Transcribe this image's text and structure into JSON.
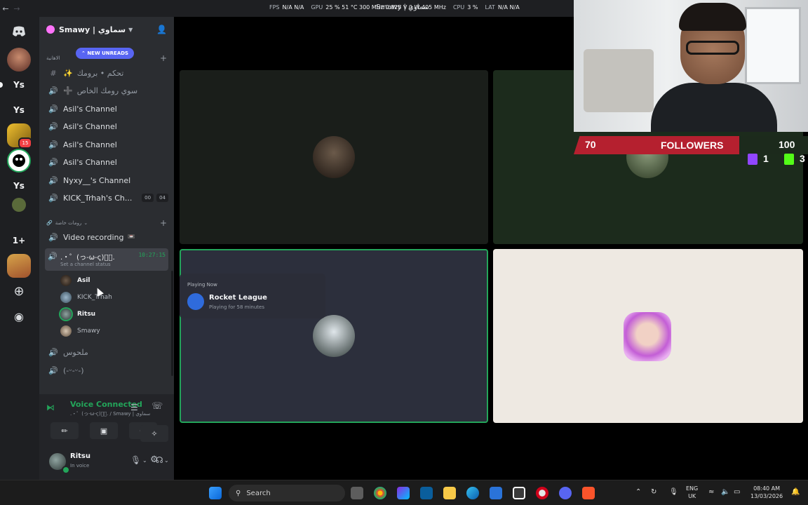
{
  "perf": [
    {
      "k": "FPS",
      "v": "N/A N/A"
    },
    {
      "k": "GPU",
      "v": "25 % 51 °C 300 MHz 0.825 V 0 W 405 MHz"
    },
    {
      "k": "CPU",
      "v": "3 %"
    },
    {
      "k": "LAT",
      "v": "N/A N/A"
    }
  ],
  "window_title": "Smawy | سماوي",
  "server": {
    "name": "Smawy | سماوي",
    "new_unreads": "NEW UNREADS",
    "categories": {
      "top": "الاهانية",
      "private": "رومات خاصة"
    },
    "channels": [
      {
        "icon": "#",
        "name": "تحكم • برومك",
        "emoji": "✨"
      },
      {
        "icon": "speaker",
        "name": "سوي رومك الخاص",
        "emoji": "➕"
      },
      {
        "icon": "speaker",
        "name": "Asil's Channel"
      },
      {
        "icon": "speaker",
        "name": "Asil's Channel"
      },
      {
        "icon": "speaker",
        "name": "Asil's Channel"
      },
      {
        "icon": "speaker",
        "name": "Asil's Channel"
      },
      {
        "icon": "speaker",
        "name": "Nyxy__'s Channel"
      },
      {
        "icon": "speaker",
        "name": "KICK_Trhah's Ch...",
        "count_a": "00",
        "count_b": "04"
      },
      {
        "icon": "speaker",
        "name": "Video recording",
        "emoji": "📼"
      }
    ],
    "active_channel": {
      "name": ".・゜(っ-ω-ς)ﾟ・.",
      "status": "Set a channel status",
      "timer": "10:27:15"
    },
    "voice_users": [
      {
        "name": "Asil"
      },
      {
        "name": "KICK_Trhah"
      },
      {
        "name": "Ritsu"
      },
      {
        "name": "Smawy"
      }
    ],
    "more_channels": [
      {
        "name": "ملحوس"
      },
      {
        "name": "(-ᵕ-ᵕ-)"
      }
    ]
  },
  "rail": {
    "badge_count": "15",
    "ys_label": "Ys",
    "plus_one": "1+"
  },
  "voice": {
    "title": "Voice Connected",
    "sub": ".・゜(っ-ω-ς)ﾟ・. / Smawy | سماوي"
  },
  "user": {
    "name": "Ritsu",
    "status": "In voice"
  },
  "activity": {
    "label": "Playing Now",
    "game": "Rocket League",
    "duration": "Playing for 58 minutes"
  },
  "overlay": {
    "left_count": "70",
    "label": "FOLLOWERS",
    "right_count": "100",
    "twitch_count": "1",
    "kick_count": "3"
  },
  "taskbar": {
    "search": "Search",
    "lang_top": "ENG",
    "lang_bottom": "UK",
    "time": "08:40 AM",
    "date": "13/03/2026"
  },
  "colors": {
    "accent": "#5865f2",
    "online": "#23a55a",
    "overlay_red": "#b5202f"
  }
}
